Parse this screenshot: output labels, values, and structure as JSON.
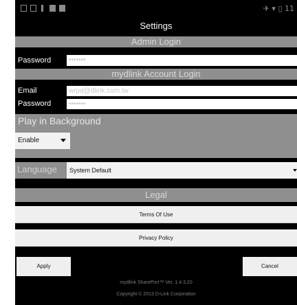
{
  "status_bar": {
    "right_text": "11",
    "icons": [
      "sim-icon",
      "screen-icon",
      "notification-icon",
      "battery-icon",
      "check-icon"
    ]
  },
  "header": {
    "title": "Settings"
  },
  "admin_login": {
    "section_title": "Admin Login",
    "password_label": "Password",
    "password_value": "•••••••"
  },
  "mydlink_login": {
    "section_title": "mydlink Account Login",
    "email_label": "Email",
    "email_value": "wrpd@dlink.com.tw",
    "password_label": "Password",
    "password_value": "•••••••"
  },
  "play_background": {
    "title": "Play in Background",
    "selected_option": "Enable"
  },
  "language": {
    "label": "Language",
    "selected_option": "System Default"
  },
  "legal": {
    "section_title": "Legal",
    "terms_label": "Terms Of Use",
    "privacy_label": "Privacy Policy"
  },
  "actions": {
    "apply_label": "Apply",
    "cancel_label": "Cancel"
  },
  "footer": {
    "version": "mydlink SharePort™ Ver. 1.4.3.20",
    "copyright": "Copyright © 2013 D-Link Corporation"
  },
  "colors": {
    "background": "#000000",
    "section_header": "#8f8f8f",
    "button": "#efefef"
  }
}
